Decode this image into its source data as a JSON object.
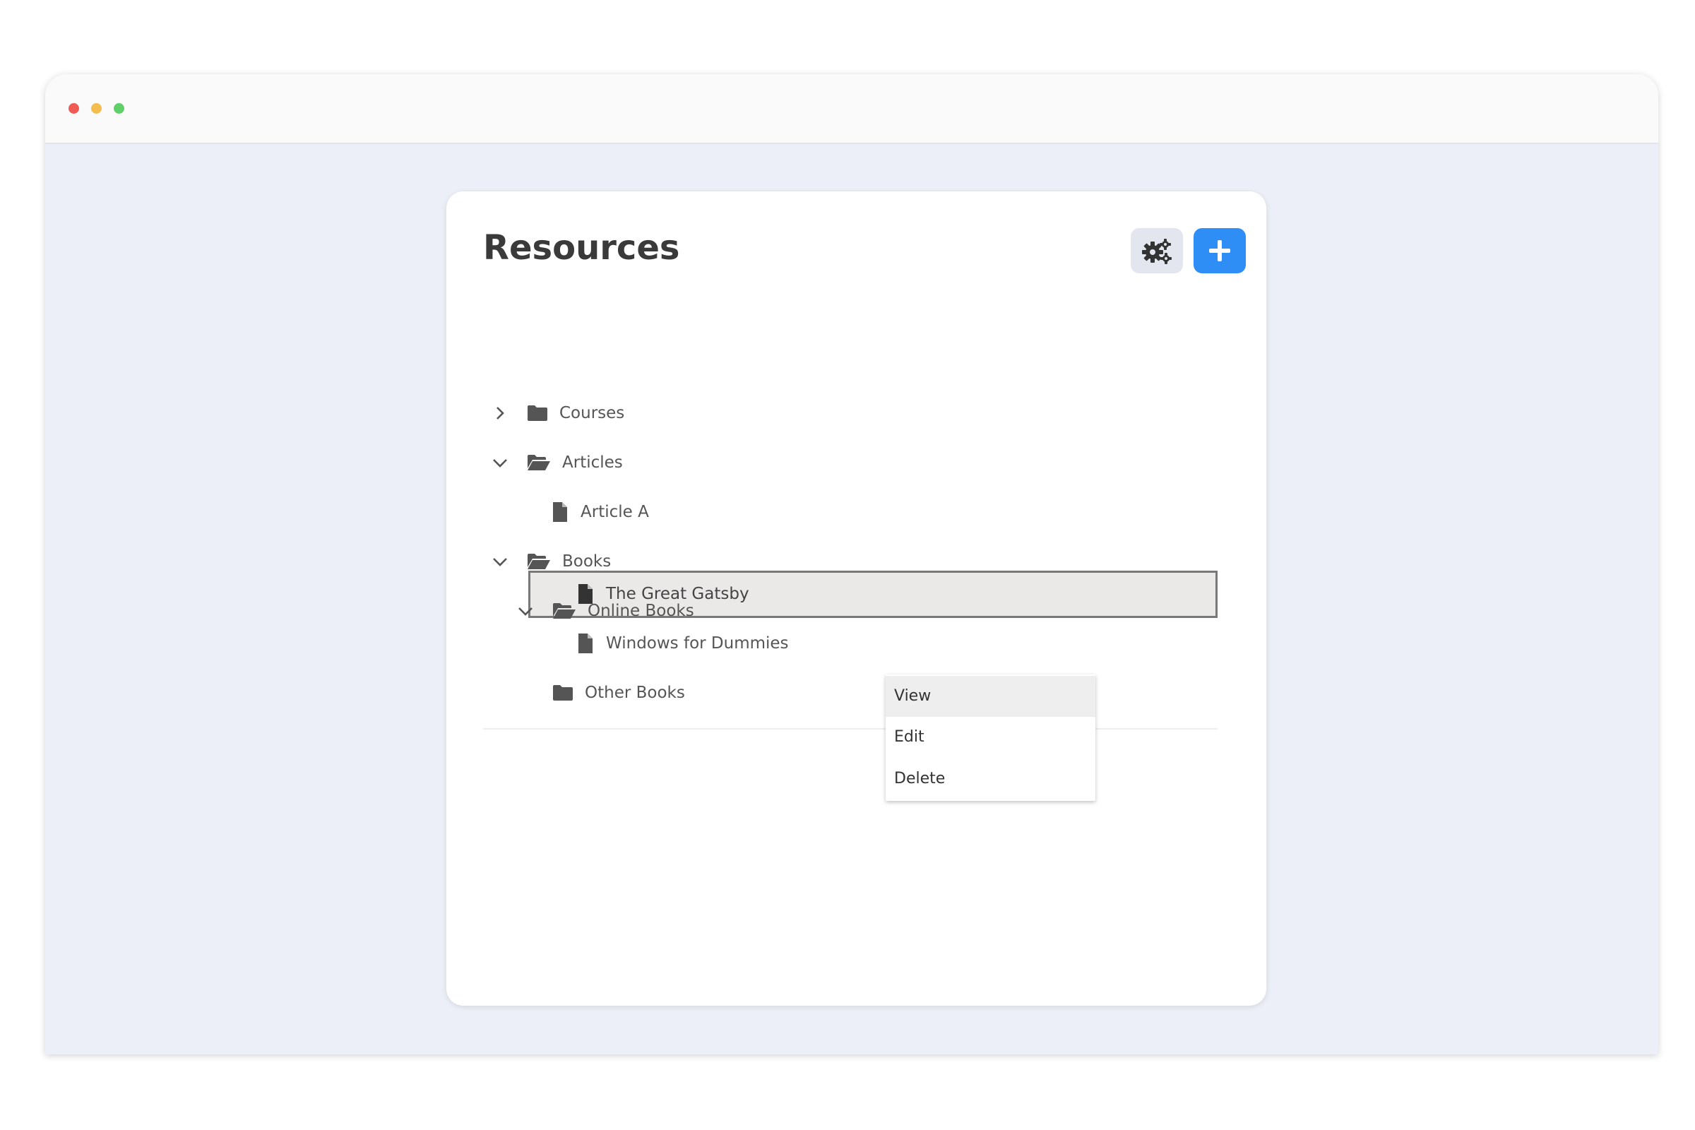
{
  "panel": {
    "title": "Resources"
  },
  "toolbar": {
    "settings_icon": "gears-icon",
    "add_icon": "plus-icon"
  },
  "tree": [
    {
      "label": "Courses",
      "icon": "folder-icon",
      "expander": "chevron-right-icon"
    },
    {
      "label": "Articles",
      "icon": "folder-open-icon",
      "expander": "chevron-down-icon"
    },
    {
      "label": "Article A",
      "icon": "file-icon"
    },
    {
      "label": "Books",
      "icon": "folder-open-icon",
      "expander": "chevron-down-icon"
    },
    {
      "label": "Online Books",
      "icon": "folder-open-icon",
      "expander": "chevron-down-icon"
    },
    {
      "label": "The Great Gatsby",
      "icon": "file-icon",
      "selected": true
    },
    {
      "label": "Windows for Dummies",
      "icon": "file-icon"
    },
    {
      "label": "Other Books",
      "icon": "folder-icon"
    }
  ],
  "context_menu": {
    "items": [
      "View",
      "Edit",
      "Delete"
    ],
    "highlighted": "View"
  },
  "colors": {
    "accent": "#2f8ef5",
    "background": "#eceff7",
    "selection": "#ebe9e7"
  }
}
